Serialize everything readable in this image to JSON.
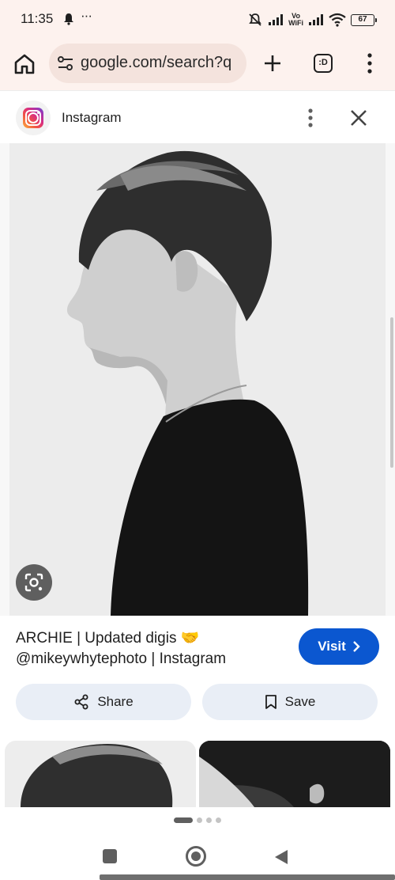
{
  "status_bar": {
    "time": "11:35",
    "more": "···",
    "vowifi_top": "Vo",
    "vowifi_bottom": "WiFi",
    "battery": "67"
  },
  "browser": {
    "url": "google.com/search?q",
    "tabs_label": ":D"
  },
  "source": {
    "name": "Instagram"
  },
  "result": {
    "title_line1": "ARCHIE | Updated digis 🤝",
    "title_line2": "@mikeywhytephoto | Instagram",
    "visit_label": "Visit",
    "share_label": "Share",
    "save_label": "Save"
  },
  "colors": {
    "accent": "#0b57d0",
    "pill_bg": "#e9eef6",
    "chrome_bg": "#fdf2ee"
  },
  "icons": [
    "bell-icon",
    "mute-icon",
    "signal-icon",
    "wifi-icon",
    "battery-icon",
    "home-icon",
    "tune-icon",
    "plus-icon",
    "tabs-icon",
    "kebab-icon",
    "instagram-icon",
    "close-icon",
    "lens-icon",
    "chevron-right-icon",
    "share-icon",
    "bookmark-icon",
    "recents-icon",
    "nav-home-icon",
    "back-icon"
  ]
}
